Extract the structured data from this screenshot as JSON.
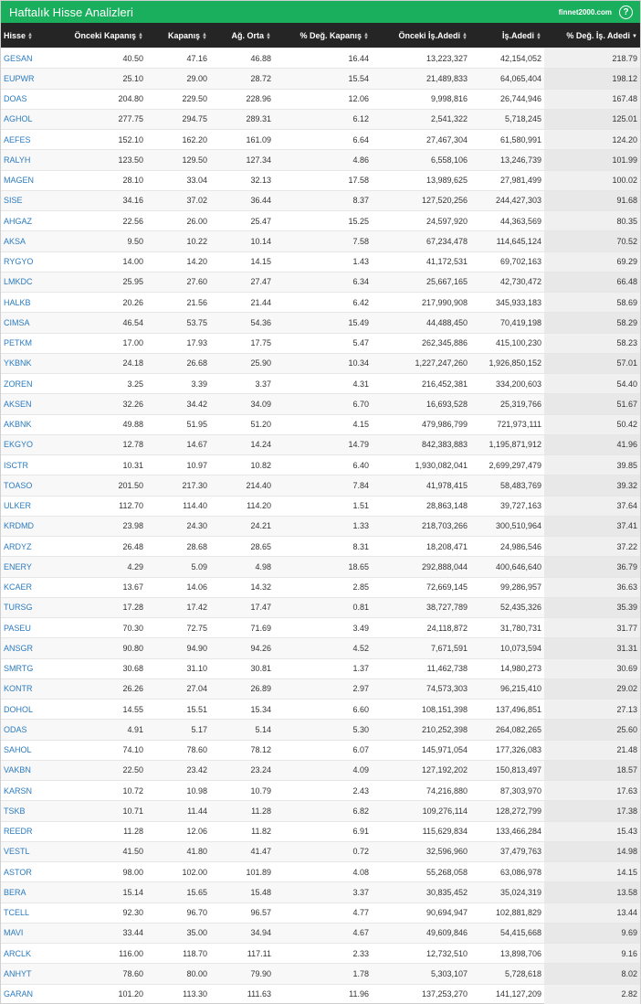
{
  "header": {
    "title": "Haftalık Hisse Analizleri",
    "brand": "finnet2000.com",
    "help": "?"
  },
  "columns": [
    "Hisse",
    "Önceki Kapanış",
    "Kapanış",
    "Ağ. Orta",
    "% Değ. Kapanış",
    "Önceki İş.Adedi",
    "İş.Adedi",
    "% Değ. İş. Adedi"
  ],
  "rows": [
    [
      "GESAN",
      "40.50",
      "47.16",
      "46.88",
      "16.44",
      "13,223,327",
      "42,154,052",
      "218.79"
    ],
    [
      "EUPWR",
      "25.10",
      "29.00",
      "28.72",
      "15.54",
      "21,489,833",
      "64,065,404",
      "198.12"
    ],
    [
      "DOAS",
      "204.80",
      "229.50",
      "228.96",
      "12.06",
      "9,998,816",
      "26,744,946",
      "167.48"
    ],
    [
      "AGHOL",
      "277.75",
      "294.75",
      "289.31",
      "6.12",
      "2,541,322",
      "5,718,245",
      "125.01"
    ],
    [
      "AEFES",
      "152.10",
      "162.20",
      "161.09",
      "6.64",
      "27,467,304",
      "61,580,991",
      "124.20"
    ],
    [
      "RALYH",
      "123.50",
      "129.50",
      "127.34",
      "4.86",
      "6,558,106",
      "13,246,739",
      "101.99"
    ],
    [
      "MAGEN",
      "28.10",
      "33.04",
      "32.13",
      "17.58",
      "13,989,625",
      "27,981,499",
      "100.02"
    ],
    [
      "SISE",
      "34.16",
      "37.02",
      "36.44",
      "8.37",
      "127,520,256",
      "244,427,303",
      "91.68"
    ],
    [
      "AHGAZ",
      "22.56",
      "26.00",
      "25.47",
      "15.25",
      "24,597,920",
      "44,363,569",
      "80.35"
    ],
    [
      "AKSA",
      "9.50",
      "10.22",
      "10.14",
      "7.58",
      "67,234,478",
      "114,645,124",
      "70.52"
    ],
    [
      "RYGYO",
      "14.00",
      "14.20",
      "14.15",
      "1.43",
      "41,172,531",
      "69,702,163",
      "69.29"
    ],
    [
      "LMKDC",
      "25.95",
      "27.60",
      "27.47",
      "6.34",
      "25,667,165",
      "42,730,472",
      "66.48"
    ],
    [
      "HALKB",
      "20.26",
      "21.56",
      "21.44",
      "6.42",
      "217,990,908",
      "345,933,183",
      "58.69"
    ],
    [
      "CIMSA",
      "46.54",
      "53.75",
      "54.36",
      "15.49",
      "44,488,450",
      "70,419,198",
      "58.29"
    ],
    [
      "PETKM",
      "17.00",
      "17.93",
      "17.75",
      "5.47",
      "262,345,886",
      "415,100,230",
      "58.23"
    ],
    [
      "YKBNK",
      "24.18",
      "26.68",
      "25.90",
      "10.34",
      "1,227,247,260",
      "1,926,850,152",
      "57.01"
    ],
    [
      "ZOREN",
      "3.25",
      "3.39",
      "3.37",
      "4.31",
      "216,452,381",
      "334,200,603",
      "54.40"
    ],
    [
      "AKSEN",
      "32.26",
      "34.42",
      "34.09",
      "6.70",
      "16,693,528",
      "25,319,766",
      "51.67"
    ],
    [
      "AKBNK",
      "49.88",
      "51.95",
      "51.20",
      "4.15",
      "479,986,799",
      "721,973,111",
      "50.42"
    ],
    [
      "EKGYO",
      "12.78",
      "14.67",
      "14.24",
      "14.79",
      "842,383,883",
      "1,195,871,912",
      "41.96"
    ],
    [
      "ISCTR",
      "10.31",
      "10.97",
      "10.82",
      "6.40",
      "1,930,082,041",
      "2,699,297,479",
      "39.85"
    ],
    [
      "TOASO",
      "201.50",
      "217.30",
      "214.40",
      "7.84",
      "41,978,415",
      "58,483,769",
      "39.32"
    ],
    [
      "ULKER",
      "112.70",
      "114.40",
      "114.20",
      "1.51",
      "28,863,148",
      "39,727,163",
      "37.64"
    ],
    [
      "KRDMD",
      "23.98",
      "24.30",
      "24.21",
      "1.33",
      "218,703,266",
      "300,510,964",
      "37.41"
    ],
    [
      "ARDYZ",
      "26.48",
      "28.68",
      "28.65",
      "8.31",
      "18,208,471",
      "24,986,546",
      "37.22"
    ],
    [
      "ENERY",
      "4.29",
      "5.09",
      "4.98",
      "18.65",
      "292,888,044",
      "400,646,640",
      "36.79"
    ],
    [
      "KCAER",
      "13.67",
      "14.06",
      "14.32",
      "2.85",
      "72,669,145",
      "99,286,957",
      "36.63"
    ],
    [
      "TURSG",
      "17.28",
      "17.42",
      "17.47",
      "0.81",
      "38,727,789",
      "52,435,326",
      "35.39"
    ],
    [
      "PASEU",
      "70.30",
      "72.75",
      "71.69",
      "3.49",
      "24,118,872",
      "31,780,731",
      "31.77"
    ],
    [
      "ANSGR",
      "90.80",
      "94.90",
      "94.26",
      "4.52",
      "7,671,591",
      "10,073,594",
      "31.31"
    ],
    [
      "SMRTG",
      "30.68",
      "31.10",
      "30.81",
      "1.37",
      "11,462,738",
      "14,980,273",
      "30.69"
    ],
    [
      "KONTR",
      "26.26",
      "27.04",
      "26.89",
      "2.97",
      "74,573,303",
      "96,215,410",
      "29.02"
    ],
    [
      "DOHOL",
      "14.55",
      "15.51",
      "15.34",
      "6.60",
      "108,151,398",
      "137,496,851",
      "27.13"
    ],
    [
      "ODAS",
      "4.91",
      "5.17",
      "5.14",
      "5.30",
      "210,252,398",
      "264,082,265",
      "25.60"
    ],
    [
      "SAHOL",
      "74.10",
      "78.60",
      "78.12",
      "6.07",
      "145,971,054",
      "177,326,083",
      "21.48"
    ],
    [
      "VAKBN",
      "22.50",
      "23.42",
      "23.24",
      "4.09",
      "127,192,202",
      "150,813,497",
      "18.57"
    ],
    [
      "KARSN",
      "10.72",
      "10.98",
      "10.79",
      "2.43",
      "74,216,880",
      "87,303,970",
      "17.63"
    ],
    [
      "TSKB",
      "10.71",
      "11.44",
      "11.28",
      "6.82",
      "109,276,114",
      "128,272,799",
      "17.38"
    ],
    [
      "REEDR",
      "11.28",
      "12.06",
      "11.82",
      "6.91",
      "115,629,834",
      "133,466,284",
      "15.43"
    ],
    [
      "VESTL",
      "41.50",
      "41.80",
      "41.47",
      "0.72",
      "32,596,960",
      "37,479,763",
      "14.98"
    ],
    [
      "ASTOR",
      "98.00",
      "102.00",
      "101.89",
      "4.08",
      "55,268,058",
      "63,086,978",
      "14.15"
    ],
    [
      "BERA",
      "15.14",
      "15.65",
      "15.48",
      "3.37",
      "30,835,452",
      "35,024,319",
      "13.58"
    ],
    [
      "TCELL",
      "92.30",
      "96.70",
      "96.57",
      "4.77",
      "90,694,947",
      "102,881,829",
      "13.44"
    ],
    [
      "MAVI",
      "33.44",
      "35.00",
      "34.94",
      "4.67",
      "49,609,846",
      "54,415,668",
      "9.69"
    ],
    [
      "ARCLK",
      "116.00",
      "118.70",
      "117.11",
      "2.33",
      "12,732,510",
      "13,898,706",
      "9.16"
    ],
    [
      "ANHYT",
      "78.60",
      "80.00",
      "79.90",
      "1.78",
      "5,303,107",
      "5,728,618",
      "8.02"
    ],
    [
      "GARAN",
      "101.20",
      "113.30",
      "111.63",
      "11.96",
      "137,253,270",
      "141,127,209",
      "2.82"
    ]
  ]
}
